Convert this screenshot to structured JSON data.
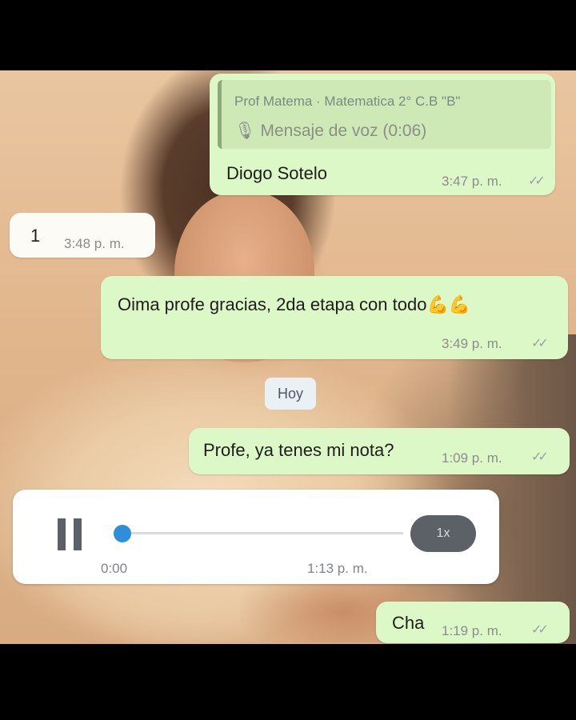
{
  "chat": {
    "reply": {
      "quote_author": "Prof Matema · Matematica 2° C.B \"B\"",
      "quote_text": "🎙 Mensaje de voz (0:06)",
      "text": "Diogo Sotelo",
      "time": "3:47 p. m."
    },
    "messages": [
      {
        "text": "1",
        "time": "3:48 p. m."
      },
      {
        "text": "Oima profe gracias, 2da etapa con todo💪💪",
        "time": "3:49 p. m."
      },
      {
        "text": "Profe, ya tenes mi nota?",
        "time": "1:09 p. m."
      },
      {
        "text": "Cha",
        "time": "1:19 p. m."
      }
    ],
    "date_chip": "Hoy",
    "voice": {
      "speed": "1x",
      "duration": "0:00",
      "time": "1:13 p. m.",
      "progress": 0
    },
    "ticks": "✓✓"
  },
  "colors": {
    "outgoing_bubble": "#dcf8c6",
    "incoming_bubble": "#fdfbf6",
    "voice_accent": "#2d8fd9"
  }
}
